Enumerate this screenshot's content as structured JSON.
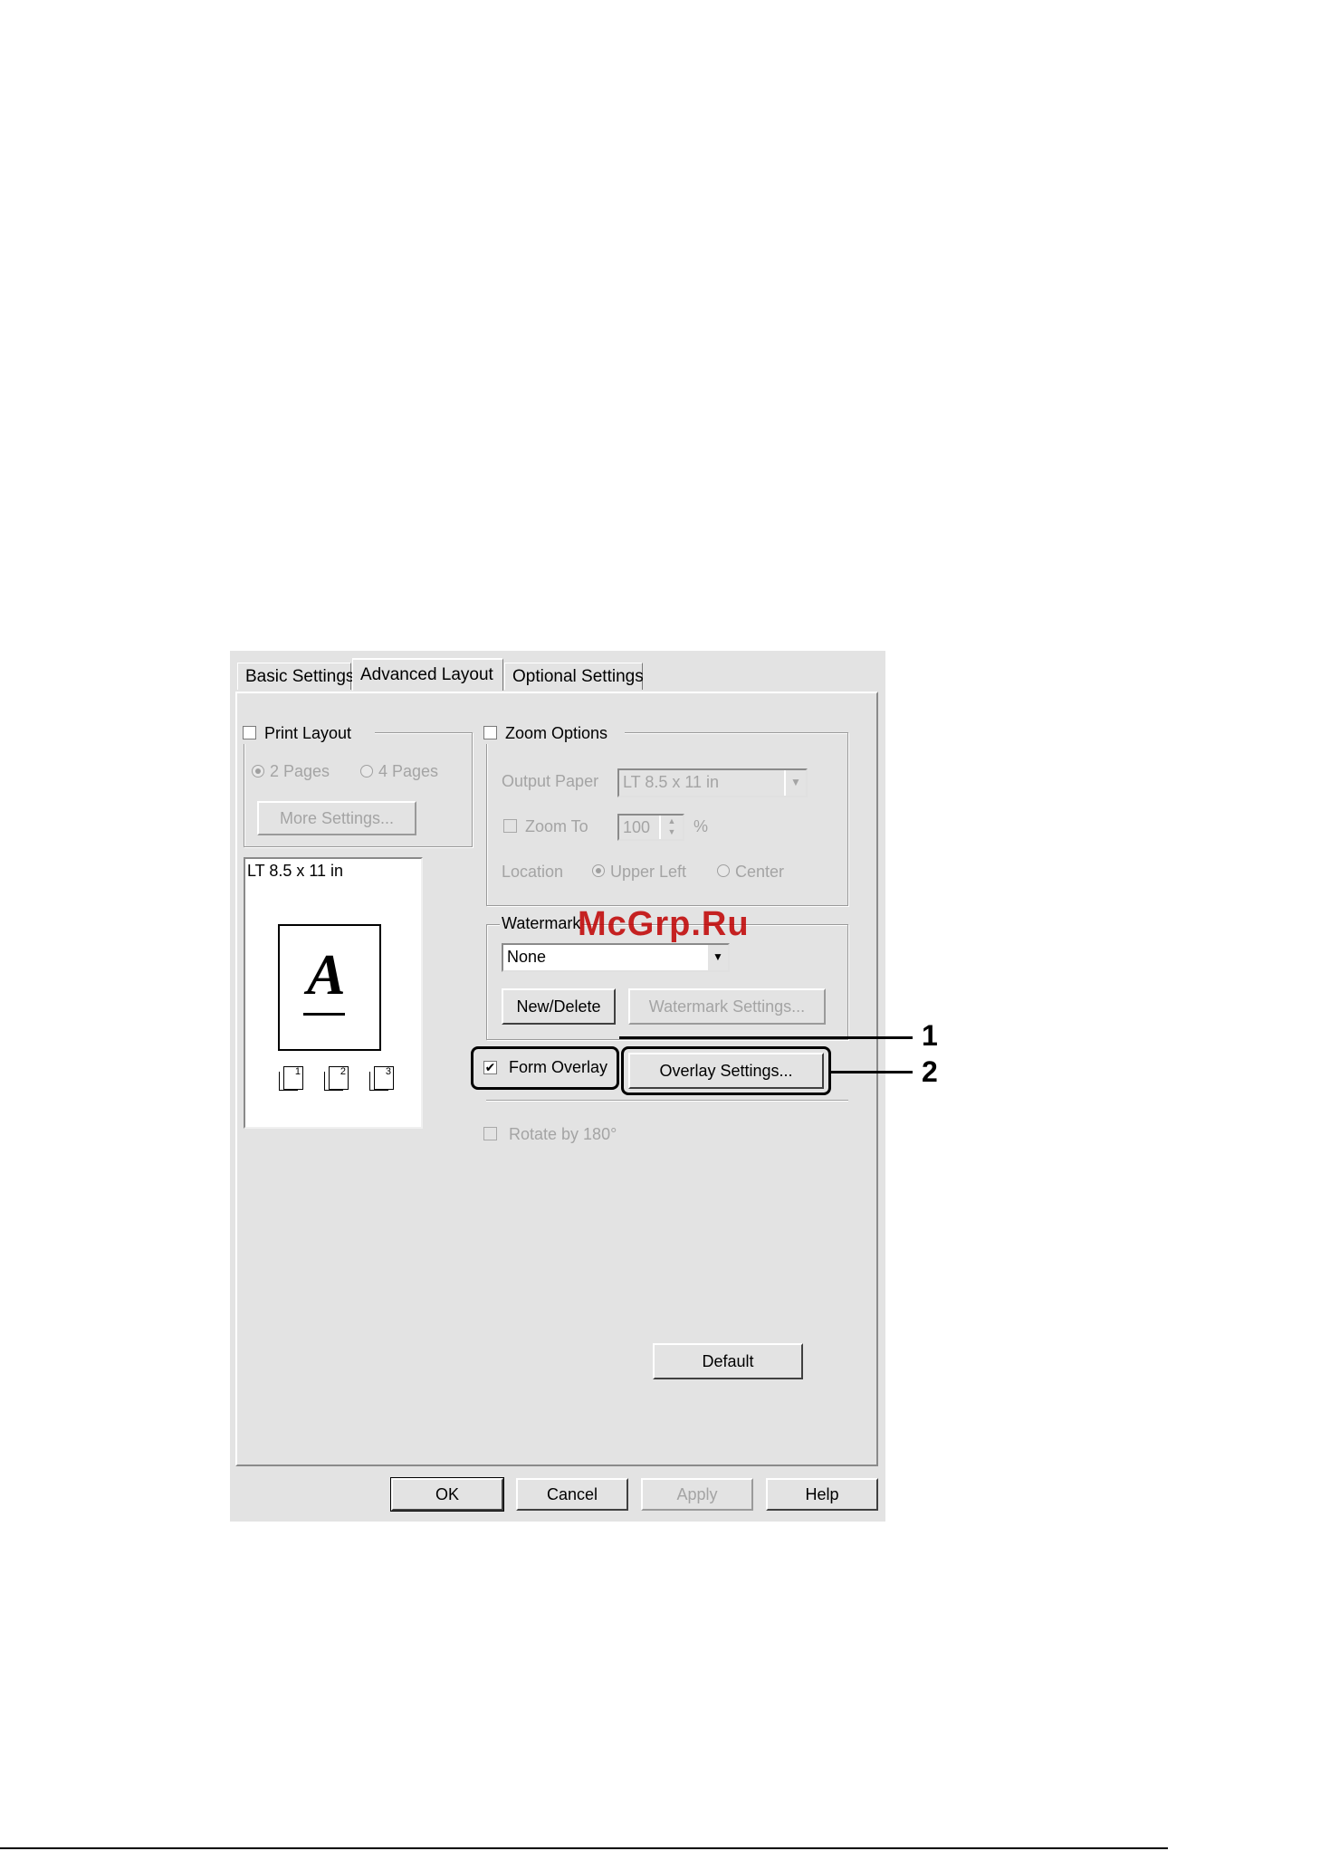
{
  "watermark_text": "McGrp.Ru",
  "tabs": [
    {
      "label": "Basic Settings",
      "active": false
    },
    {
      "label": "Advanced Layout",
      "active": true
    },
    {
      "label": "Optional Settings",
      "active": false
    }
  ],
  "print_layout": {
    "label": "Print Layout",
    "checked": false,
    "options": [
      {
        "label": "2 Pages",
        "selected": true
      },
      {
        "label": "4 Pages",
        "selected": false
      }
    ],
    "more_settings_label": "More Settings..."
  },
  "preview": {
    "paper_label": "LT 8.5 x 11 in",
    "letter": "A",
    "page_icons": [
      "1",
      "2",
      "3"
    ]
  },
  "zoom_options": {
    "label": "Zoom Options",
    "checked": false,
    "output_paper_label": "Output Paper",
    "output_paper_value": "LT 8.5 x 11 in",
    "zoom_to_label": "Zoom To",
    "zoom_to_value": "100",
    "zoom_unit": "%",
    "location_label": "Location",
    "location_options": [
      {
        "label": "Upper Left",
        "selected": true
      },
      {
        "label": "Center",
        "selected": false
      }
    ]
  },
  "watermark": {
    "label": "Watermark",
    "value": "None",
    "new_delete_label": "New/Delete",
    "settings_label": "Watermark Settings..."
  },
  "form_overlay": {
    "label": "Form Overlay",
    "checked": true,
    "check_glyph": "✔",
    "settings_label": "Overlay Settings..."
  },
  "rotate": {
    "label": "Rotate by 180°",
    "checked": false
  },
  "default_label": "Default",
  "footer_buttons": {
    "ok": "OK",
    "cancel": "Cancel",
    "apply": "Apply",
    "help": "Help"
  },
  "callouts": [
    "1",
    "2"
  ],
  "colors": {
    "dialog_bg": "#e3e3e3",
    "disabled_text": "#a4a4a4",
    "watermark_text": "#c00000"
  }
}
